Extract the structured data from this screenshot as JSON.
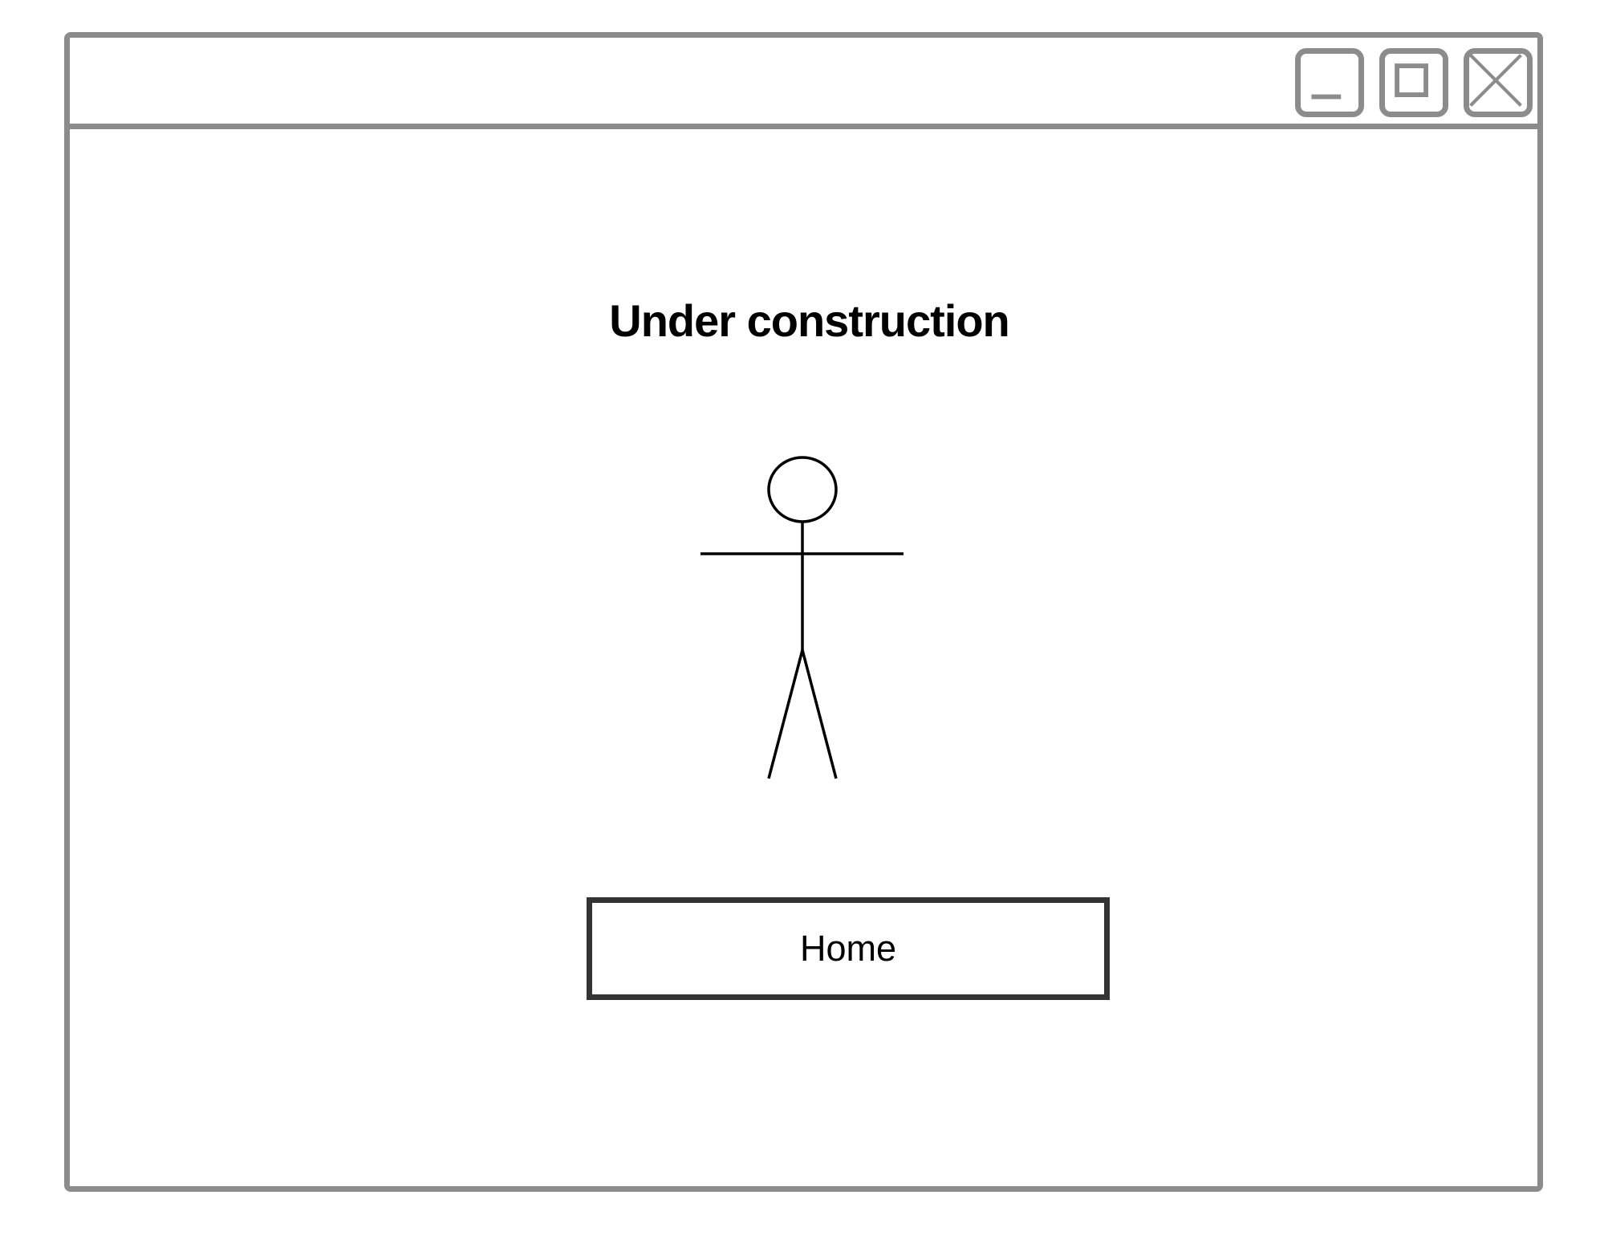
{
  "window": {
    "controls": {
      "minimize_icon": "minimize-icon",
      "maximize_icon": "maximize-icon",
      "close_icon": "close-icon"
    }
  },
  "main": {
    "heading": "Under construction",
    "illustration": "stick-figure",
    "home_button_label": "Home"
  },
  "colors": {
    "frame": "#8c8c8c",
    "button_border": "#333333",
    "text": "#000000",
    "background": "#ffffff"
  }
}
